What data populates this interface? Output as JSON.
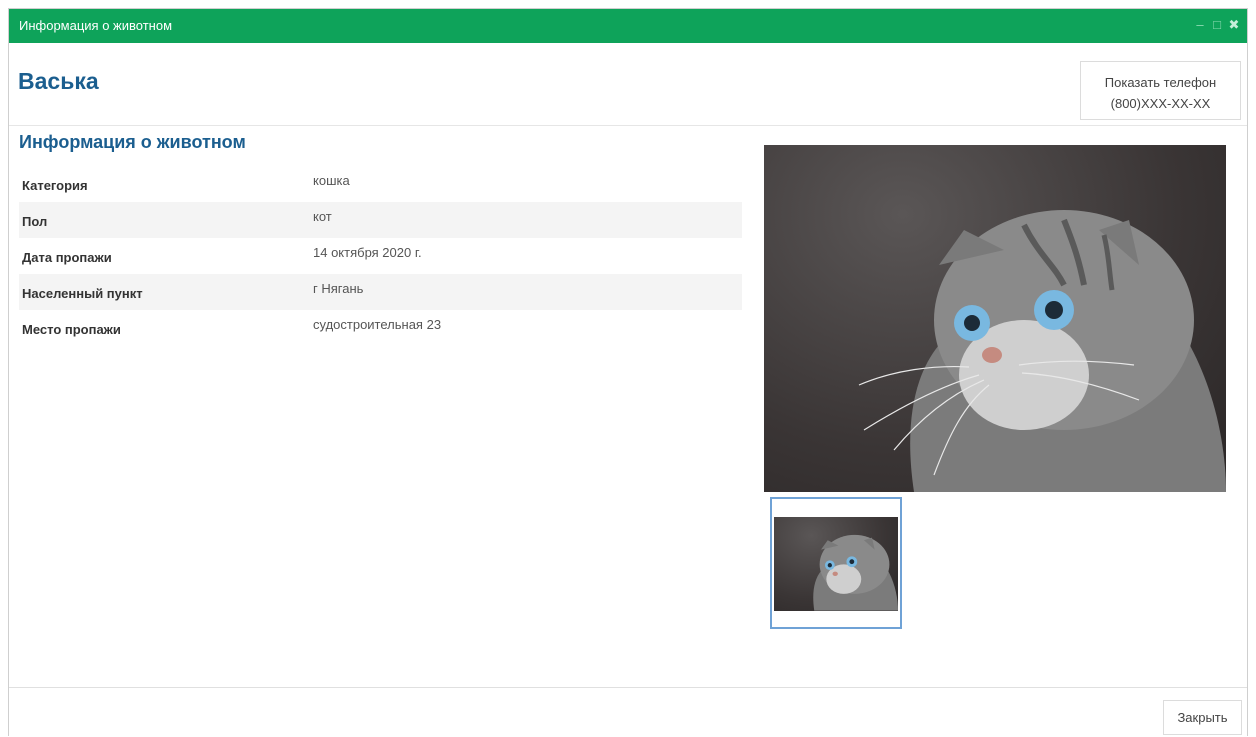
{
  "window": {
    "title": "Информация о животном",
    "controls": [
      "minimize-icon",
      "maximize-icon",
      "close-icon"
    ],
    "accent_color": "#0ea35a"
  },
  "header": {
    "pet_name": "Васька",
    "phone_button": {
      "label": "Показать телефон",
      "phone": "(800)XXX-XX-XX"
    }
  },
  "info": {
    "section_title": "Информация о животном",
    "rows": [
      {
        "label": "Категория",
        "value": "кошка"
      },
      {
        "label": "Пол",
        "value": "кот"
      },
      {
        "label": "Дата пропажи",
        "value": "14 октября 2020 г."
      },
      {
        "label": "Населенный пункт",
        "value": "г Нягань"
      },
      {
        "label": "Место пропажи",
        "value": "судостроительная 23"
      }
    ]
  },
  "gallery": {
    "main_photo": "cat-photo",
    "thumbnails": [
      "cat-photo"
    ]
  },
  "footer": {
    "close_label": "Закрыть"
  }
}
